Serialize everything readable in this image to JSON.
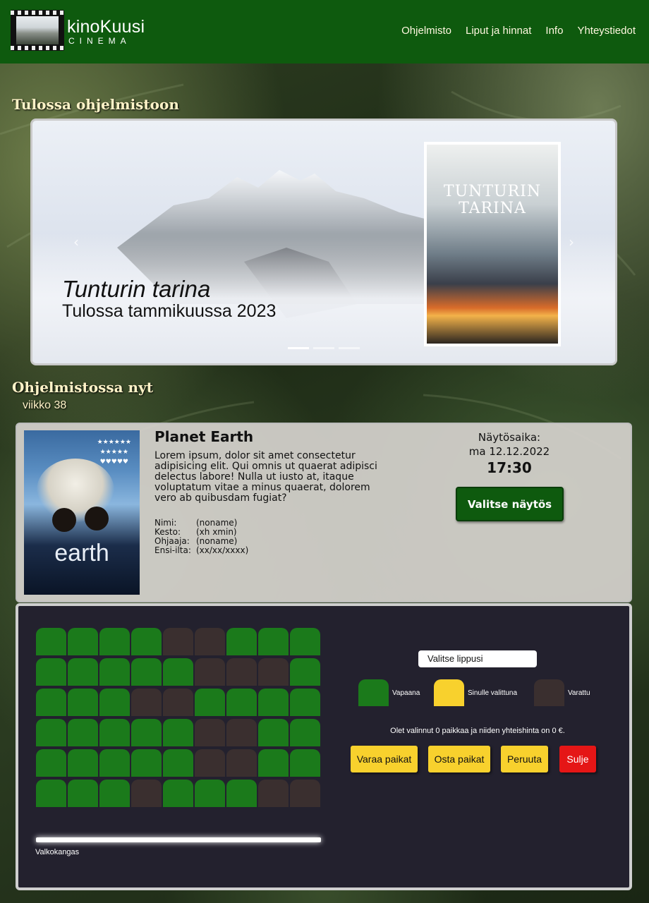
{
  "header": {
    "logo_main": "kinoKuusi",
    "logo_sub": "CINEMA",
    "nav": [
      "Ohjelmisto",
      "Liput ja hinnat",
      "Info",
      "Yhteystiedot"
    ]
  },
  "upcoming": {
    "heading": "Tulossa ohjelmistoon",
    "slide_title": "Tunturin tarina",
    "slide_subtitle": "Tulossa tammikuussa 2023",
    "poster_title": "TUNTURIN TARINA",
    "prev_icon": "‹",
    "next_icon": "›",
    "slides_count": 3,
    "active_slide": 1
  },
  "now_showing": {
    "heading": "Ohjelmistossa nyt",
    "week": "viikko 38",
    "movie": {
      "title": "Planet Earth",
      "description": "Lorem ipsum, dolor sit amet consectetur adipisicing elit. Qui omnis ut quaerat adipisci delectus labore! Nulla ut iusto at, itaque voluptatum vitae a minus quaerat, dolorem vero ab quibusdam fugiat?",
      "meta": [
        {
          "key": "Nimi:",
          "value": "(noname)"
        },
        {
          "key": "Kesto:",
          "value": "(xh xmin)"
        },
        {
          "key": "Ohjaaja:",
          "value": "(noname)"
        },
        {
          "key": "Ensi-ilta:",
          "value": "(xx/xx/xxxx)"
        }
      ],
      "poster_text": "earth",
      "showtime_label": "Näytösaika:",
      "showtime_date": "ma 12.12.2022",
      "showtime_time": "17:30",
      "select_button": "Valitse näytös"
    }
  },
  "booking": {
    "seats": [
      [
        "free",
        "free",
        "free",
        "free",
        "taken",
        "taken",
        "free",
        "free",
        "free"
      ],
      [
        "free",
        "free",
        "free",
        "free",
        "free",
        "taken",
        "taken",
        "taken",
        "free"
      ],
      [
        "free",
        "free",
        "free",
        "taken",
        "taken",
        "free",
        "free",
        "free",
        "free"
      ],
      [
        "free",
        "free",
        "free",
        "free",
        "free",
        "taken",
        "taken",
        "free",
        "free"
      ],
      [
        "free",
        "free",
        "free",
        "free",
        "free",
        "taken",
        "taken",
        "free",
        "free"
      ],
      [
        "free",
        "free",
        "free",
        "taken",
        "free",
        "free",
        "free",
        "taken",
        "taken"
      ]
    ],
    "screen_label": "Valkokangas",
    "ticket_select": "Valitse lippusi",
    "legend": {
      "free": "Vapaana",
      "selected": "Sinulle valittuna",
      "taken": "Varattu"
    },
    "summary": "Olet valinnut 0 paikkaa ja niiden yhteishinta on 0 €.",
    "buttons": {
      "reserve": "Varaa paikat",
      "buy": "Osta paikat",
      "cancel": "Peruuta",
      "close": "Sulje"
    },
    "colors": {
      "free": "#1b7a1b",
      "selected": "#f8d12d",
      "taken": "#3a2f2f"
    }
  }
}
